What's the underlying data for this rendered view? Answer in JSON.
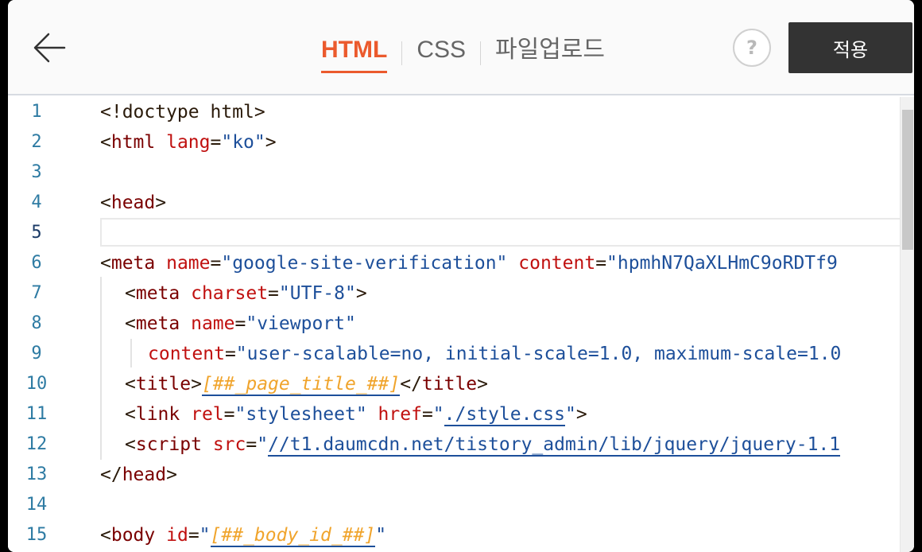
{
  "header": {
    "tabs": [
      {
        "label": "HTML",
        "active": true
      },
      {
        "label": "CSS",
        "active": false
      },
      {
        "label": "파일업로드",
        "active": false
      }
    ],
    "help_label": "?",
    "apply_label": "적용"
  },
  "editor": {
    "current_line": 5,
    "line_numbers": [
      "1",
      "2",
      "3",
      "4",
      "5",
      "6",
      "7",
      "8",
      "9",
      "10",
      "11",
      "12",
      "13",
      "14",
      "15"
    ],
    "lines": {
      "l1": {
        "a": "<!doctype html>"
      },
      "l2": {
        "a": "<",
        "b": "html",
        "c": "lang",
        "d": "=",
        "e": "\"ko\"",
        "f": ">"
      },
      "l4": {
        "a": "<",
        "b": "head",
        "c": ">"
      },
      "l6": {
        "a": "<",
        "b": "meta",
        "c": "name",
        "d": "=",
        "e": "\"google-site-verification\"",
        "f": "content",
        "g": "=",
        "h": "\"hpmhN7QaXLHmC9oRDTf9"
      },
      "l7": {
        "a": "<",
        "b": "meta",
        "c": "charset",
        "d": "=",
        "e": "\"UTF-8\"",
        "f": ">"
      },
      "l8": {
        "a": "<",
        "b": "meta",
        "c": "name",
        "d": "=",
        "e": "\"viewport\""
      },
      "l9": {
        "a": "content",
        "b": "=",
        "c": "\"user-scalable=no, initial-scale=1.0, maximum-scale=1.0"
      },
      "l10": {
        "a": "<",
        "b": "title",
        "c": ">",
        "d": "[##_page_title_##]",
        "e": "</",
        "f": "title",
        "g": ">"
      },
      "l11": {
        "a": "<",
        "b": "link",
        "c": "rel",
        "d": "=",
        "e": "\"stylesheet\"",
        "f": "href",
        "g": "=",
        "h": "\"",
        "i": "./style.css",
        "j": "\"",
        "k": ">"
      },
      "l12": {
        "a": "<",
        "b": "script",
        "c": "src",
        "d": "=",
        "e": "\"",
        "f": "//t1.daumcdn.net/tistory_admin/lib/jquery/jquery-1.1"
      },
      "l13": {
        "a": "</",
        "b": "head",
        "c": ">"
      },
      "l15": {
        "a": "<",
        "b": "body",
        "c": "id",
        "d": "=",
        "e": "\"",
        "f": "[##_body_id_##]",
        "g": "\""
      }
    }
  },
  "colors": {
    "accent": "#eb5a2d",
    "apply_bg": "#333333",
    "line_number": "#2e7ba3",
    "string": "#1d4f9a",
    "attribute": "#c0100f",
    "template_token": "#f0a42c"
  }
}
